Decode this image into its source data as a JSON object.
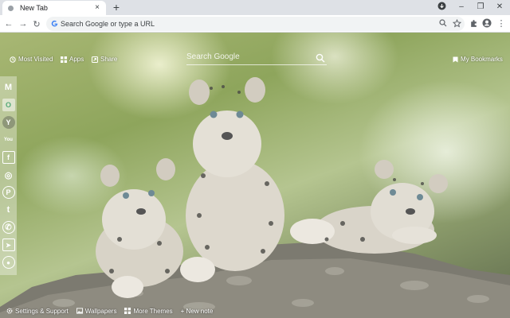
{
  "browser": {
    "tab": {
      "title": "New Tab",
      "close_glyph": "×"
    },
    "new_tab_glyph": "+",
    "window": {
      "minimize": "–",
      "restore": "❐",
      "close": "✕"
    }
  },
  "toolbar": {
    "back_glyph": "←",
    "forward_glyph": "→",
    "reload_glyph": "↻",
    "omnibox_g": "G",
    "omnibox_placeholder": "Search Google or type a URL",
    "menu_glyph": "⋮"
  },
  "newtab": {
    "top_links": [
      {
        "label": "Most Visited",
        "icon": "history-icon"
      },
      {
        "label": "Apps",
        "icon": "apps-grid-icon"
      },
      {
        "label": "Share",
        "icon": "share-icon"
      }
    ],
    "search_placeholder": "Search Google",
    "bookmarks_label": "My Bookmarks",
    "sidebar": [
      {
        "name": "gmail",
        "glyph": "M"
      },
      {
        "name": "outlook",
        "glyph": "O"
      },
      {
        "name": "yahoo",
        "glyph": "Y"
      },
      {
        "name": "youtube",
        "glyph": "You"
      },
      {
        "name": "facebook",
        "glyph": "f"
      },
      {
        "name": "instagram",
        "glyph": "◎"
      },
      {
        "name": "pinterest",
        "glyph": "P"
      },
      {
        "name": "twitter",
        "glyph": "t"
      },
      {
        "name": "whatsapp",
        "glyph": "✆"
      },
      {
        "name": "telegram",
        "glyph": "➤"
      },
      {
        "name": "reddit",
        "glyph": "●"
      }
    ],
    "bottom_links": [
      {
        "label": "Settings & Support",
        "icon": "gear-icon"
      },
      {
        "label": "Wallpapers",
        "icon": "image-icon"
      },
      {
        "label": "More Themes",
        "icon": "grid-icon"
      },
      {
        "label": "+ New note",
        "icon": ""
      }
    ]
  }
}
